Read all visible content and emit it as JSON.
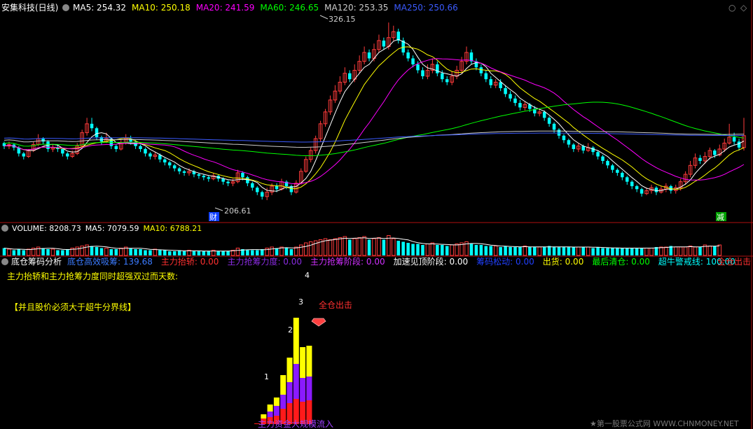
{
  "colors": {
    "up": "#ff3b3b",
    "down": "#00ffff",
    "ma5": "#ffffff",
    "ma10": "#ffff00",
    "ma20": "#ff00ff",
    "ma60": "#00ff00",
    "ma120": "#cccccc",
    "ma250": "#3b5bff",
    "panel_line": "#b01010"
  },
  "main": {
    "title": "安集科技(日线)",
    "ma": [
      {
        "label": "MA5: 254.32",
        "color": "#ffffff"
      },
      {
        "label": "MA10: 250.18",
        "color": "#ffff00"
      },
      {
        "label": "MA20: 241.59",
        "color": "#ff00ff"
      },
      {
        "label": "MA60: 246.65",
        "color": "#00ff00"
      },
      {
        "label": "MA120: 253.35",
        "color": "#cccccc"
      },
      {
        "label": "MA250: 250.66",
        "color": "#3b5bff"
      }
    ],
    "high_label": "326.15",
    "low_label": "206.61",
    "cai_marker": "财",
    "jian_marker": "减"
  },
  "volume": {
    "labels": [
      {
        "label": "VOLUME: 8208.73",
        "color": "#ffffff"
      },
      {
        "label": "MA5: 7079.59",
        "color": "#ffffff"
      },
      {
        "label": "MA10: 6788.21",
        "color": "#ffff00"
      }
    ]
  },
  "indicator": {
    "name": "底仓筹码分析",
    "labels": [
      {
        "label": "底仓高效吸筹: 139.68",
        "color": "#3b7bff"
      },
      {
        "label": "主力抬轿: 0.00",
        "color": "#ff3030"
      },
      {
        "label": "主力抢筹力度: 0.00",
        "color": "#8a2be2"
      },
      {
        "label": "主力抢筹阶段: 0.00",
        "color": "#d030ff"
      },
      {
        "label": "加速见顶阶段: 0.00",
        "color": "#ffffff"
      },
      {
        "label": "筹码松动: 0.00",
        "color": "#2040ff"
      },
      {
        "label": "出货: 0.00",
        "color": "#ffff00"
      },
      {
        "label": "最后清仓: 0.00",
        "color": "#00ff00"
      },
      {
        "label": "超牛警戒线: 100.00",
        "color": "#00ffff"
      },
      {
        "label": "全仓出击",
        "color": "#ff3030"
      }
    ],
    "note1": "主力抬轿和主力抢筹力度同时超强双过而天数:",
    "note1_value": "4",
    "note2": "【并且股价必须大于超牛分界线】",
    "bar_label_1": "1",
    "bar_label_2": "2",
    "bar_label_3": "3",
    "signal_text": "全仓出击",
    "bottom_text": "主力资金大规模流入",
    "watermark": "★第一股票公式网 WWW.CHNMONEY.NET"
  },
  "chart_data": [
    {
      "type": "candlestick",
      "title": "安集科技(日线)",
      "series_names": [
        "MA5",
        "MA10",
        "MA20",
        "MA60",
        "MA120",
        "MA250"
      ],
      "ylim": [
        200,
        330
      ],
      "annotations": [
        {
          "text": "326.15",
          "value": 326.15
        },
        {
          "text": "206.61",
          "value": 206.61
        }
      ],
      "candles": [
        [
          245,
          243,
          246,
          241
        ],
        [
          243,
          244,
          246,
          241
        ],
        [
          244,
          242,
          245,
          240
        ],
        [
          242,
          238,
          243,
          236
        ],
        [
          238,
          236,
          239,
          234
        ],
        [
          236,
          240,
          241,
          235
        ],
        [
          240,
          244,
          246,
          239
        ],
        [
          244,
          248,
          251,
          243
        ],
        [
          248,
          246,
          249,
          244
        ],
        [
          246,
          241,
          247,
          239
        ],
        [
          241,
          242,
          244,
          239
        ],
        [
          242,
          241,
          244,
          239
        ],
        [
          241,
          238,
          242,
          236
        ],
        [
          238,
          236,
          239,
          234
        ],
        [
          236,
          238,
          240,
          235
        ],
        [
          238,
          243,
          245,
          237
        ],
        [
          243,
          252,
          254,
          242
        ],
        [
          252,
          258,
          262,
          250
        ],
        [
          258,
          255,
          262,
          253
        ],
        [
          255,
          249,
          256,
          247
        ],
        [
          249,
          246,
          250,
          244
        ],
        [
          246,
          248,
          252,
          245
        ],
        [
          248,
          243,
          249,
          241
        ],
        [
          243,
          241,
          244,
          239
        ],
        [
          241,
          245,
          247,
          240
        ],
        [
          245,
          248,
          251,
          244
        ],
        [
          248,
          246,
          250,
          244
        ],
        [
          246,
          243,
          247,
          241
        ],
        [
          243,
          241,
          244,
          239
        ],
        [
          241,
          238,
          242,
          236
        ],
        [
          238,
          236,
          239,
          234
        ],
        [
          236,
          237,
          239,
          234
        ],
        [
          237,
          234,
          238,
          232
        ],
        [
          234,
          232,
          235,
          230
        ],
        [
          232,
          230,
          233,
          228
        ],
        [
          230,
          228,
          231,
          226
        ],
        [
          228,
          226,
          229,
          224
        ],
        [
          226,
          225,
          227,
          223
        ],
        [
          225,
          226,
          228,
          223
        ],
        [
          226,
          224,
          227,
          222
        ],
        [
          224,
          223,
          225,
          221
        ],
        [
          223,
          222,
          224,
          220
        ],
        [
          222,
          221,
          223,
          219
        ],
        [
          221,
          223,
          225,
          220
        ],
        [
          223,
          221,
          224,
          219
        ],
        [
          221,
          219,
          222,
          217
        ],
        [
          219,
          218,
          220,
          216
        ],
        [
          218,
          219,
          221,
          216
        ],
        [
          219,
          225,
          227,
          218
        ],
        [
          225,
          222,
          226,
          220
        ],
        [
          222,
          218,
          223,
          216
        ],
        [
          218,
          215,
          219,
          213
        ],
        [
          215,
          212,
          216,
          210
        ],
        [
          212,
          209,
          213,
          207
        ],
        [
          209,
          212,
          215,
          206.61
        ],
        [
          212,
          216,
          218,
          210
        ],
        [
          216,
          214,
          218,
          212
        ],
        [
          214,
          219,
          221,
          213
        ],
        [
          219,
          216,
          220,
          214
        ],
        [
          216,
          212,
          217,
          210
        ],
        [
          212,
          218,
          220,
          211
        ],
        [
          218,
          226,
          228,
          217
        ],
        [
          226,
          234,
          236,
          225
        ],
        [
          234,
          240,
          242,
          232
        ],
        [
          240,
          248,
          250,
          238
        ],
        [
          248,
          258,
          260,
          246
        ],
        [
          258,
          266,
          268,
          256
        ],
        [
          266,
          274,
          277,
          264
        ],
        [
          274,
          280,
          284,
          272
        ],
        [
          280,
          286,
          290,
          278
        ],
        [
          286,
          292,
          296,
          284
        ],
        [
          292,
          288,
          294,
          286
        ],
        [
          288,
          294,
          298,
          286
        ],
        [
          294,
          300,
          304,
          292
        ],
        [
          300,
          306,
          310,
          298
        ],
        [
          306,
          302,
          308,
          300
        ],
        [
          302,
          308,
          312,
          300
        ],
        [
          308,
          314,
          318,
          306
        ],
        [
          314,
          310,
          316,
          308
        ],
        [
          310,
          316,
          326.15,
          308
        ],
        [
          316,
          320,
          324,
          314
        ],
        [
          320,
          314,
          322,
          312
        ],
        [
          314,
          306,
          316,
          304
        ],
        [
          306,
          302,
          308,
          300
        ],
        [
          302,
          298,
          304,
          296
        ],
        [
          298,
          294,
          300,
          292
        ],
        [
          294,
          290,
          296,
          288
        ],
        [
          290,
          294,
          298,
          288
        ],
        [
          294,
          298,
          302,
          292
        ],
        [
          298,
          292,
          300,
          290
        ],
        [
          292,
          288,
          294,
          286
        ],
        [
          288,
          286,
          290,
          284
        ],
        [
          286,
          290,
          293,
          284
        ],
        [
          290,
          294,
          297,
          288
        ],
        [
          294,
          300,
          303,
          292
        ],
        [
          300,
          306,
          310,
          298
        ],
        [
          306,
          300,
          308,
          298
        ],
        [
          300,
          296,
          302,
          294
        ],
        [
          296,
          292,
          298,
          290
        ],
        [
          292,
          288,
          294,
          286
        ],
        [
          288,
          284,
          290,
          282
        ],
        [
          284,
          286,
          288,
          282
        ],
        [
          286,
          282,
          288,
          280
        ],
        [
          282,
          278,
          284,
          276
        ],
        [
          278,
          275,
          280,
          273
        ],
        [
          275,
          272,
          277,
          270
        ],
        [
          272,
          269,
          274,
          267
        ],
        [
          269,
          271,
          273,
          267
        ],
        [
          271,
          268,
          272,
          266
        ],
        [
          268,
          265,
          270,
          263
        ],
        [
          265,
          266,
          268,
          263
        ],
        [
          266,
          262,
          267,
          260
        ],
        [
          262,
          258,
          263,
          256
        ],
        [
          258,
          254,
          259,
          252
        ],
        [
          254,
          250,
          255,
          248
        ],
        [
          250,
          247,
          251,
          245
        ],
        [
          247,
          244,
          248,
          242
        ],
        [
          244,
          241,
          245,
          239
        ],
        [
          241,
          243,
          245,
          239
        ],
        [
          243,
          240,
          244,
          238
        ],
        [
          240,
          242,
          245,
          239
        ],
        [
          242,
          239,
          243,
          237
        ],
        [
          239,
          236,
          240,
          234
        ],
        [
          236,
          233,
          237,
          231
        ],
        [
          233,
          230,
          234,
          228
        ],
        [
          230,
          227,
          231,
          225
        ],
        [
          227,
          225,
          228,
          223
        ],
        [
          225,
          222,
          226,
          220
        ],
        [
          222,
          219,
          223,
          217
        ],
        [
          219,
          216,
          220,
          214
        ],
        [
          216,
          214,
          217,
          212
        ],
        [
          214,
          211,
          215,
          209
        ],
        [
          211,
          213,
          215,
          210
        ],
        [
          213,
          215,
          217,
          211
        ],
        [
          215,
          212,
          216,
          210
        ],
        [
          212,
          214,
          216,
          211
        ],
        [
          214,
          216,
          218,
          212
        ],
        [
          216,
          213,
          217,
          211
        ],
        [
          213,
          215,
          217,
          211
        ],
        [
          215,
          219,
          221,
          213
        ],
        [
          219,
          224,
          226,
          217
        ],
        [
          224,
          230,
          233,
          222
        ],
        [
          230,
          235,
          238,
          228
        ],
        [
          235,
          233,
          237,
          231
        ],
        [
          233,
          236,
          239,
          231
        ],
        [
          236,
          240,
          242,
          234
        ],
        [
          240,
          237,
          241,
          235
        ],
        [
          237,
          241,
          244,
          236
        ],
        [
          241,
          245,
          248,
          239
        ],
        [
          245,
          249,
          258,
          244
        ],
        [
          249,
          246,
          252,
          244
        ],
        [
          246,
          242,
          248,
          240
        ],
        [
          242,
          250,
          262,
          240
        ]
      ]
    },
    {
      "type": "bar",
      "title": "VOLUME",
      "values": [
        7,
        6,
        5,
        6,
        5,
        6,
        7,
        8,
        7,
        6,
        6,
        5,
        5,
        6,
        7,
        8,
        9,
        10,
        9,
        8,
        7,
        7,
        6,
        6,
        7,
        8,
        7,
        6,
        6,
        5,
        5,
        6,
        5,
        5,
        4,
        4,
        5,
        4,
        5,
        4,
        4,
        4,
        4,
        5,
        4,
        4,
        4,
        5,
        7,
        6,
        5,
        5,
        5,
        6,
        7,
        8,
        7,
        8,
        7,
        6,
        8,
        10,
        12,
        13,
        14,
        15,
        16,
        15,
        16,
        17,
        18,
        15,
        16,
        17,
        18,
        15,
        16,
        17,
        15,
        19,
        16,
        14,
        13,
        12,
        11,
        11,
        10,
        11,
        12,
        10,
        10,
        9,
        10,
        11,
        12,
        13,
        11,
        10,
        10,
        9,
        9,
        9,
        8,
        9,
        8,
        8,
        8,
        9,
        8,
        8,
        8,
        8,
        9,
        8,
        8,
        8,
        8,
        8,
        8,
        8,
        8,
        7,
        8,
        7,
        7,
        7,
        7,
        7,
        7,
        7,
        7,
        7,
        7,
        7,
        8,
        8,
        8,
        9,
        8,
        8,
        8,
        9,
        8,
        8,
        10,
        9,
        9,
        10
      ]
    },
    {
      "type": "bar",
      "title": "底仓筹码分析",
      "stacked": true,
      "series_names": [
        "主力抬轿",
        "主力抢筹力度",
        "主力抢筹阶段"
      ],
      "bars": [
        {
          "red": 1,
          "purple": 0,
          "yellow": 0
        },
        {
          "red": 8,
          "purple": 0,
          "yellow": 6
        },
        {
          "red": 10,
          "purple": 8,
          "yellow": 10
        },
        {
          "red": 12,
          "purple": 14,
          "yellow": 12
        },
        {
          "red": 22,
          "purple": 20,
          "yellow": 28
        },
        {
          "red": 30,
          "purple": 30,
          "yellow": 35
        },
        {
          "red": 36,
          "purple": 50,
          "yellow": 66
        },
        {
          "red": 32,
          "purple": 34,
          "yellow": 44
        },
        {
          "red": 34,
          "purple": 34,
          "yellow": 44
        }
      ]
    }
  ]
}
